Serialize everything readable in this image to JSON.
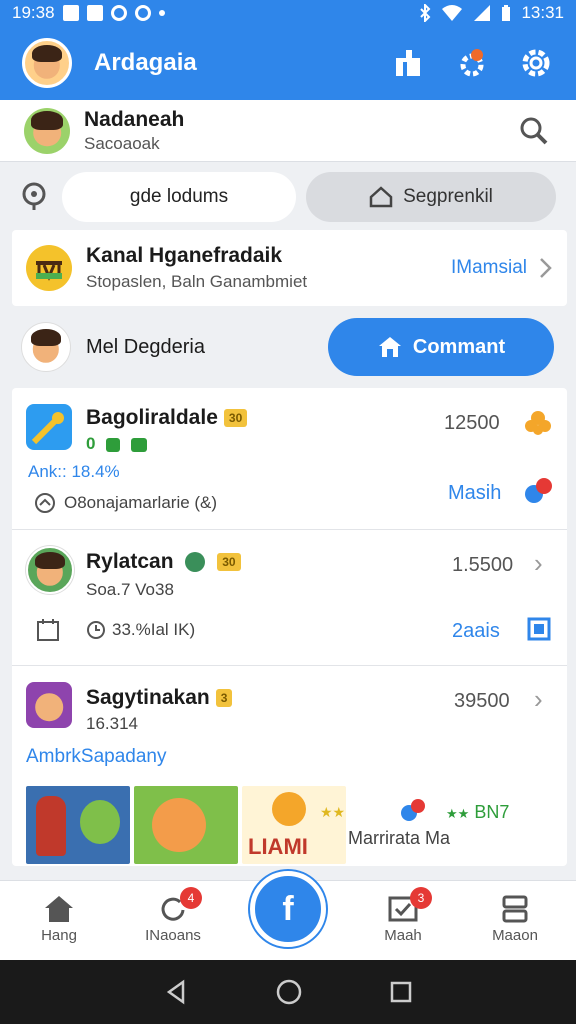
{
  "status_bar": {
    "time_left": "19:38",
    "time_right": "13:31",
    "bluetooth_icon": "bluetooth-icon",
    "wifi_icon": "wifi-icon",
    "signal_icon": "signal-icon",
    "battery_icon": "battery-icon"
  },
  "app_bar": {
    "title": "Ardagaia",
    "action_icons": [
      "clipboard-icon",
      "badge-settings-icon",
      "gear-icon"
    ]
  },
  "profile": {
    "name": "Nadaneah",
    "subtitle": "Sacoaoak"
  },
  "tabs": [
    {
      "label": "gde lodums",
      "active": true
    },
    {
      "label": "Segprenkil",
      "active": false,
      "icon": "home-outline-icon"
    }
  ],
  "channel": {
    "title": "Kanal Hganefradaik",
    "subtitle": "Stopaslen, Baln Ganambmiet",
    "link": "IMamsial"
  },
  "comment_row": {
    "name": "Mel Degderia",
    "button_label": "Commant"
  },
  "items": [
    {
      "title": "Bagoliraldale",
      "badge": "30",
      "line2": "0",
      "stat": "Ank:: 18.4%",
      "footer": "O8onajamarlarie (&)",
      "value": "12500",
      "link": "Masih"
    },
    {
      "title": "Rylatcan",
      "badge": "30",
      "line2": "Soa.7 Vo38",
      "footer": "33.%Ial IK)",
      "value": "1.5500",
      "link": "2aais"
    },
    {
      "title": "Sagytinakan",
      "badge": "3",
      "line2": "16.314",
      "stat": "AmbrkSapadany",
      "value": "39500",
      "thumb_caption": "LIAMI",
      "promo_value": "BN7",
      "promo_caption": "Marrirata Ma"
    }
  ],
  "bottom_nav": [
    {
      "label": "Hang",
      "icon": "home-icon"
    },
    {
      "label": "INaoans",
      "icon": "refresh-icon",
      "badge": "4"
    },
    {
      "label": "Maah",
      "icon": "check-box-icon",
      "badge": "3"
    },
    {
      "label": "Maaon",
      "icon": "menu-icon"
    }
  ],
  "fab_label": "f",
  "colors": {
    "primary": "#2f86ea",
    "accent_green": "#2e9d3a",
    "badge_red": "#e53935",
    "badge_yellow": "#f2c23c"
  }
}
